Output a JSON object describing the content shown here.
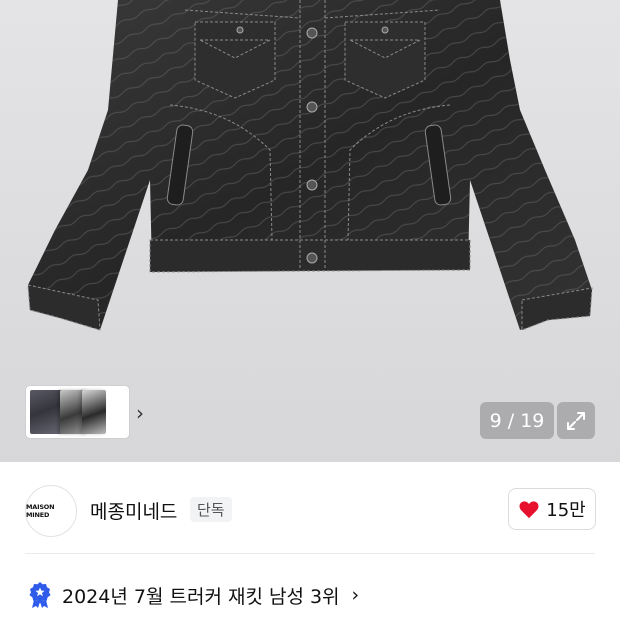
{
  "gallery": {
    "counter": "9 / 19",
    "thumbnail_chevron": "›",
    "expand_icon": "expand-icon"
  },
  "brand": {
    "logo_text": "MAISON MINED",
    "name": "메종미네드",
    "badge": "단독"
  },
  "like": {
    "icon": "heart-icon",
    "count": "15만",
    "color": "#e8112d"
  },
  "ranking": {
    "icon": "ranking-badge-icon",
    "text": "2024년 7월 트러커 재킷 남성 3위",
    "chevron": "›",
    "color": "#2f5bea"
  }
}
